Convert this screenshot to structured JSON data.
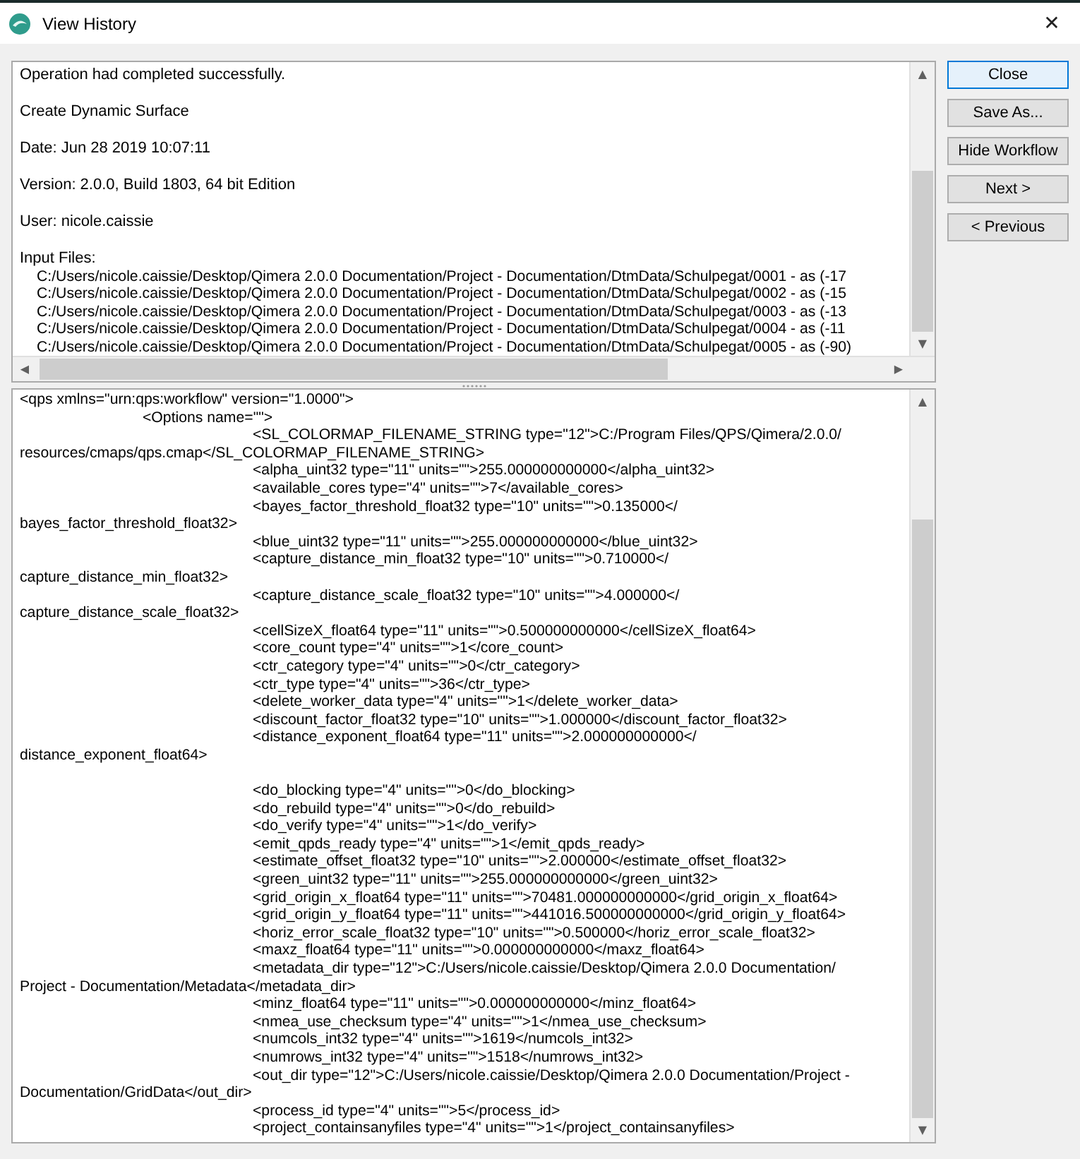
{
  "window": {
    "title": "View History",
    "close": "✕"
  },
  "summary": [
    "Operation had completed successfully.",
    "Create Dynamic Surface",
    "Date: Jun 28 2019 10:07:11",
    "Version: 2.0.0, Build 1803, 64 bit Edition",
    "User: nicole.caissie"
  ],
  "input_files": {
    "label": "Input Files:",
    "files": [
      "C:/Users/nicole.caissie/Desktop/Qimera 2.0.0 Documentation/Project - Documentation/DtmData/Schulpegat/0001 - as (-17",
      "C:/Users/nicole.caissie/Desktop/Qimera 2.0.0 Documentation/Project - Documentation/DtmData/Schulpegat/0002 - as (-15",
      "C:/Users/nicole.caissie/Desktop/Qimera 2.0.0 Documentation/Project - Documentation/DtmData/Schulpegat/0003 - as (-13",
      "C:/Users/nicole.caissie/Desktop/Qimera 2.0.0 Documentation/Project - Documentation/DtmData/Schulpegat/0004 - as (-11",
      "C:/Users/nicole.caissie/Desktop/Qimera 2.0.0 Documentation/Project - Documentation/DtmData/Schulpegat/0005 - as (-90)"
    ]
  },
  "workflow_lines": [
    {
      "kind": "root",
      "text": "<qps xmlns=\"urn:qps:workflow\" version=\"1.0000\">"
    },
    {
      "kind": "options",
      "text": "<Options name=\"\">"
    },
    {
      "kind": "option",
      "text": "<SL_COLORMAP_FILENAME_STRING type=\"12\">C:/Program Files/QPS/Qimera/2.0.0/"
    },
    {
      "kind": "wrap",
      "text": "resources/cmaps/qps.cmap</SL_COLORMAP_FILENAME_STRING>"
    },
    {
      "kind": "option",
      "text": "<alpha_uint32 type=\"11\" units=\"\">255.000000000000</alpha_uint32>"
    },
    {
      "kind": "option",
      "text": "<available_cores type=\"4\" units=\"\">7</available_cores>"
    },
    {
      "kind": "option",
      "text": "<bayes_factor_threshold_float32 type=\"10\" units=\"\">0.135000</"
    },
    {
      "kind": "wrap",
      "text": "bayes_factor_threshold_float32>"
    },
    {
      "kind": "option",
      "text": "<blue_uint32 type=\"11\" units=\"\">255.000000000000</blue_uint32>"
    },
    {
      "kind": "option",
      "text": "<capture_distance_min_float32 type=\"10\" units=\"\">0.710000</"
    },
    {
      "kind": "wrap",
      "text": "capture_distance_min_float32>"
    },
    {
      "kind": "option",
      "text": "<capture_distance_scale_float32 type=\"10\" units=\"\">4.000000</"
    },
    {
      "kind": "wrap",
      "text": "capture_distance_scale_float32>"
    },
    {
      "kind": "option",
      "text": "<cellSizeX_float64 type=\"11\" units=\"\">0.500000000000</cellSizeX_float64>"
    },
    {
      "kind": "option",
      "text": "<core_count type=\"4\" units=\"\">1</core_count>"
    },
    {
      "kind": "option",
      "text": "<ctr_category type=\"4\" units=\"\">0</ctr_category>"
    },
    {
      "kind": "option",
      "text": "<ctr_type type=\"4\" units=\"\">36</ctr_type>"
    },
    {
      "kind": "option",
      "text": "<delete_worker_data type=\"4\" units=\"\">1</delete_worker_data>"
    },
    {
      "kind": "option",
      "text": "<discount_factor_float32 type=\"10\" units=\"\">1.000000</discount_factor_float32>"
    },
    {
      "kind": "option",
      "text": "<distance_exponent_float64 type=\"11\" units=\"\">2.000000000000</"
    },
    {
      "kind": "wrap",
      "text": "distance_exponent_float64>"
    },
    {
      "kind": "blank"
    },
    {
      "kind": "option",
      "text": "<do_blocking type=\"4\" units=\"\">0</do_blocking>"
    },
    {
      "kind": "option",
      "text": "<do_rebuild type=\"4\" units=\"\">0</do_rebuild>"
    },
    {
      "kind": "option",
      "text": "<do_verify type=\"4\" units=\"\">1</do_verify>"
    },
    {
      "kind": "option",
      "text": "<emit_qpds_ready type=\"4\" units=\"\">1</emit_qpds_ready>"
    },
    {
      "kind": "option",
      "text": "<estimate_offset_float32 type=\"10\" units=\"\">2.000000</estimate_offset_float32>"
    },
    {
      "kind": "option",
      "text": "<green_uint32 type=\"11\" units=\"\">255.000000000000</green_uint32>"
    },
    {
      "kind": "option",
      "text": "<grid_origin_x_float64 type=\"11\" units=\"\">70481.000000000000</grid_origin_x_float64>"
    },
    {
      "kind": "option",
      "text": "<grid_origin_y_float64 type=\"11\" units=\"\">441016.500000000000</grid_origin_y_float64>"
    },
    {
      "kind": "option",
      "text": "<horiz_error_scale_float32 type=\"10\" units=\"\">0.500000</horiz_error_scale_float32>"
    },
    {
      "kind": "option",
      "text": "<maxz_float64 type=\"11\" units=\"\">0.000000000000</maxz_float64>"
    },
    {
      "kind": "option",
      "text": "<metadata_dir type=\"12\">C:/Users/nicole.caissie/Desktop/Qimera 2.0.0 Documentation/"
    },
    {
      "kind": "wrap",
      "text": "Project - Documentation/Metadata</metadata_dir>"
    },
    {
      "kind": "option",
      "text": "<minz_float64 type=\"11\" units=\"\">0.000000000000</minz_float64>"
    },
    {
      "kind": "option",
      "text": "<nmea_use_checksum type=\"4\" units=\"\">1</nmea_use_checksum>"
    },
    {
      "kind": "option",
      "text": "<numcols_int32 type=\"4\" units=\"\">1619</numcols_int32>"
    },
    {
      "kind": "option",
      "text": "<numrows_int32 type=\"4\" units=\"\">1518</numrows_int32>"
    },
    {
      "kind": "option",
      "text": "<out_dir type=\"12\">C:/Users/nicole.caissie/Desktop/Qimera 2.0.0 Documentation/Project -"
    },
    {
      "kind": "wrap",
      "text": "Documentation/GridData</out_dir>"
    },
    {
      "kind": "option",
      "text": "<process_id type=\"4\" units=\"\">5</process_id>"
    },
    {
      "kind": "option",
      "text": "<project_containsanyfiles type=\"4\" units=\"\">1</project_containsanyfiles>"
    }
  ],
  "buttons": [
    {
      "label": "Close",
      "default": true
    },
    {
      "label": "Save As...",
      "default": false
    },
    {
      "label": "Hide Workflow",
      "default": false
    },
    {
      "label": "Next >",
      "default": false
    },
    {
      "label": "< Previous",
      "default": false
    }
  ],
  "scroll_arrows": {
    "up": "▲",
    "down": "▼",
    "left": "◀",
    "right": "▶"
  }
}
